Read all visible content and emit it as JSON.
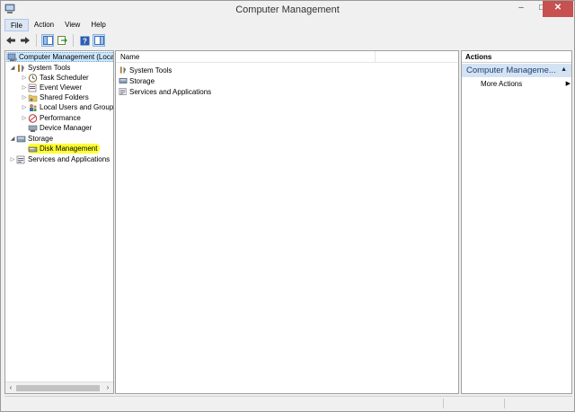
{
  "window": {
    "title": "Computer Management",
    "minimize_glyph": "–",
    "maximize_glyph": "□",
    "close_glyph": "✕"
  },
  "menu": [
    "File",
    "Action",
    "View",
    "Help"
  ],
  "toolbar": {
    "buttons": [
      "back-arrow-icon",
      "forward-arrow-icon",
      "show-hide-tree-icon",
      "export-list-icon",
      "help-icon",
      "show-action-pane-icon"
    ]
  },
  "tree": {
    "root": "Computer Management (Local",
    "system_tools": "System Tools",
    "task_scheduler": "Task Scheduler",
    "event_viewer": "Event Viewer",
    "shared_folders": "Shared Folders",
    "local_users": "Local Users and Groups",
    "performance": "Performance",
    "device_manager": "Device Manager",
    "storage": "Storage",
    "disk_management": "Disk Management",
    "services": "Services and Applications"
  },
  "list": {
    "header_name": "Name",
    "items": [
      "System Tools",
      "Storage",
      "Services and Applications"
    ]
  },
  "actions": {
    "header": "Actions",
    "group": "Computer Manageme...",
    "item": "More Actions"
  },
  "colors": {
    "highlight": "#ffff33",
    "selection": "#cce8ff",
    "actions_group_bg": "#d4e3f3",
    "close_button": "#c75050"
  }
}
